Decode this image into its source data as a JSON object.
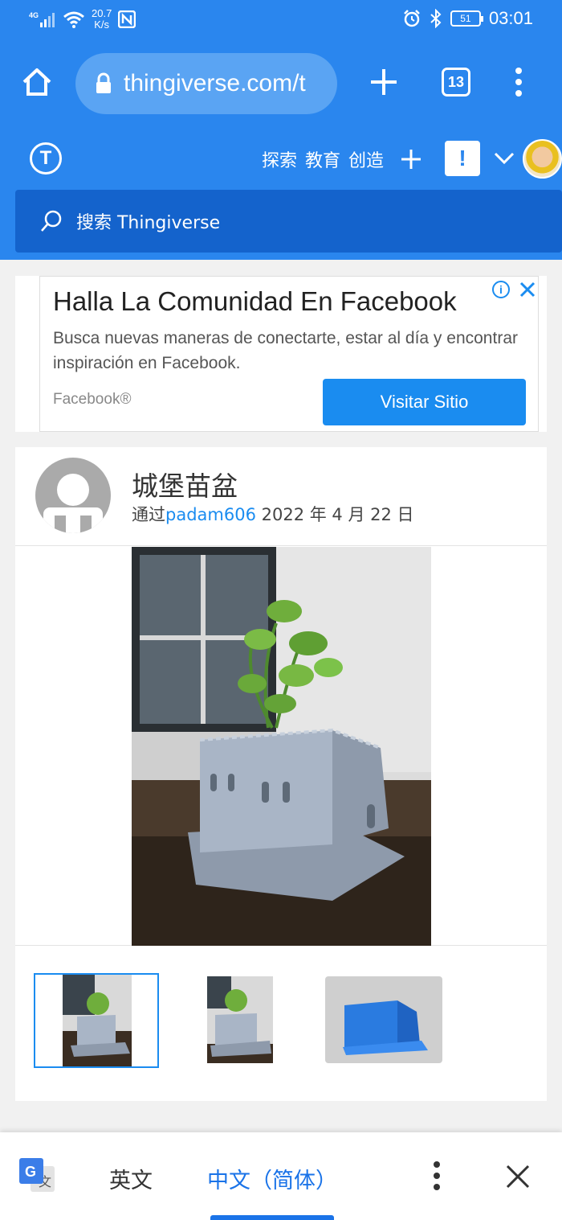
{
  "status_bar": {
    "network": "4G",
    "speed": "20.7\nK/s",
    "battery": "51",
    "time": "03:01",
    "icons": [
      "signal-icon",
      "wifi-icon",
      "nfc-icon",
      "alarm-icon",
      "bluetooth-icon",
      "battery-icon"
    ]
  },
  "browser": {
    "url": "thingiverse.com/t",
    "tab_count": "13"
  },
  "site_header": {
    "logo": "T",
    "nav": [
      "探索",
      "教育",
      "创造"
    ],
    "alert": "!",
    "search_placeholder": "搜索 Thingiverse"
  },
  "ad": {
    "title": "Halla La Comunidad En Facebook",
    "description": "Busca nuevas maneras de conectarte, estar al día y encontrar inspiración en Facebook.",
    "brand": "Facebook®",
    "cta": "Visitar Sitio",
    "info": "i"
  },
  "thing": {
    "title": "城堡苗盆",
    "by_prefix": "通过",
    "author": "padam606",
    "date": " 2022 年 4 月 22 日",
    "thumbnails": 3,
    "selected_thumbnail": 1
  },
  "translate_bar": {
    "source_lang": "英文",
    "target_lang": "中文（简体）",
    "selected": "中文（简体）"
  },
  "colors": {
    "brand_blue": "#2a86ee",
    "search_blue": "#1463cc",
    "link_blue": "#1a8cf0",
    "translate_blue": "#1a73e8"
  }
}
